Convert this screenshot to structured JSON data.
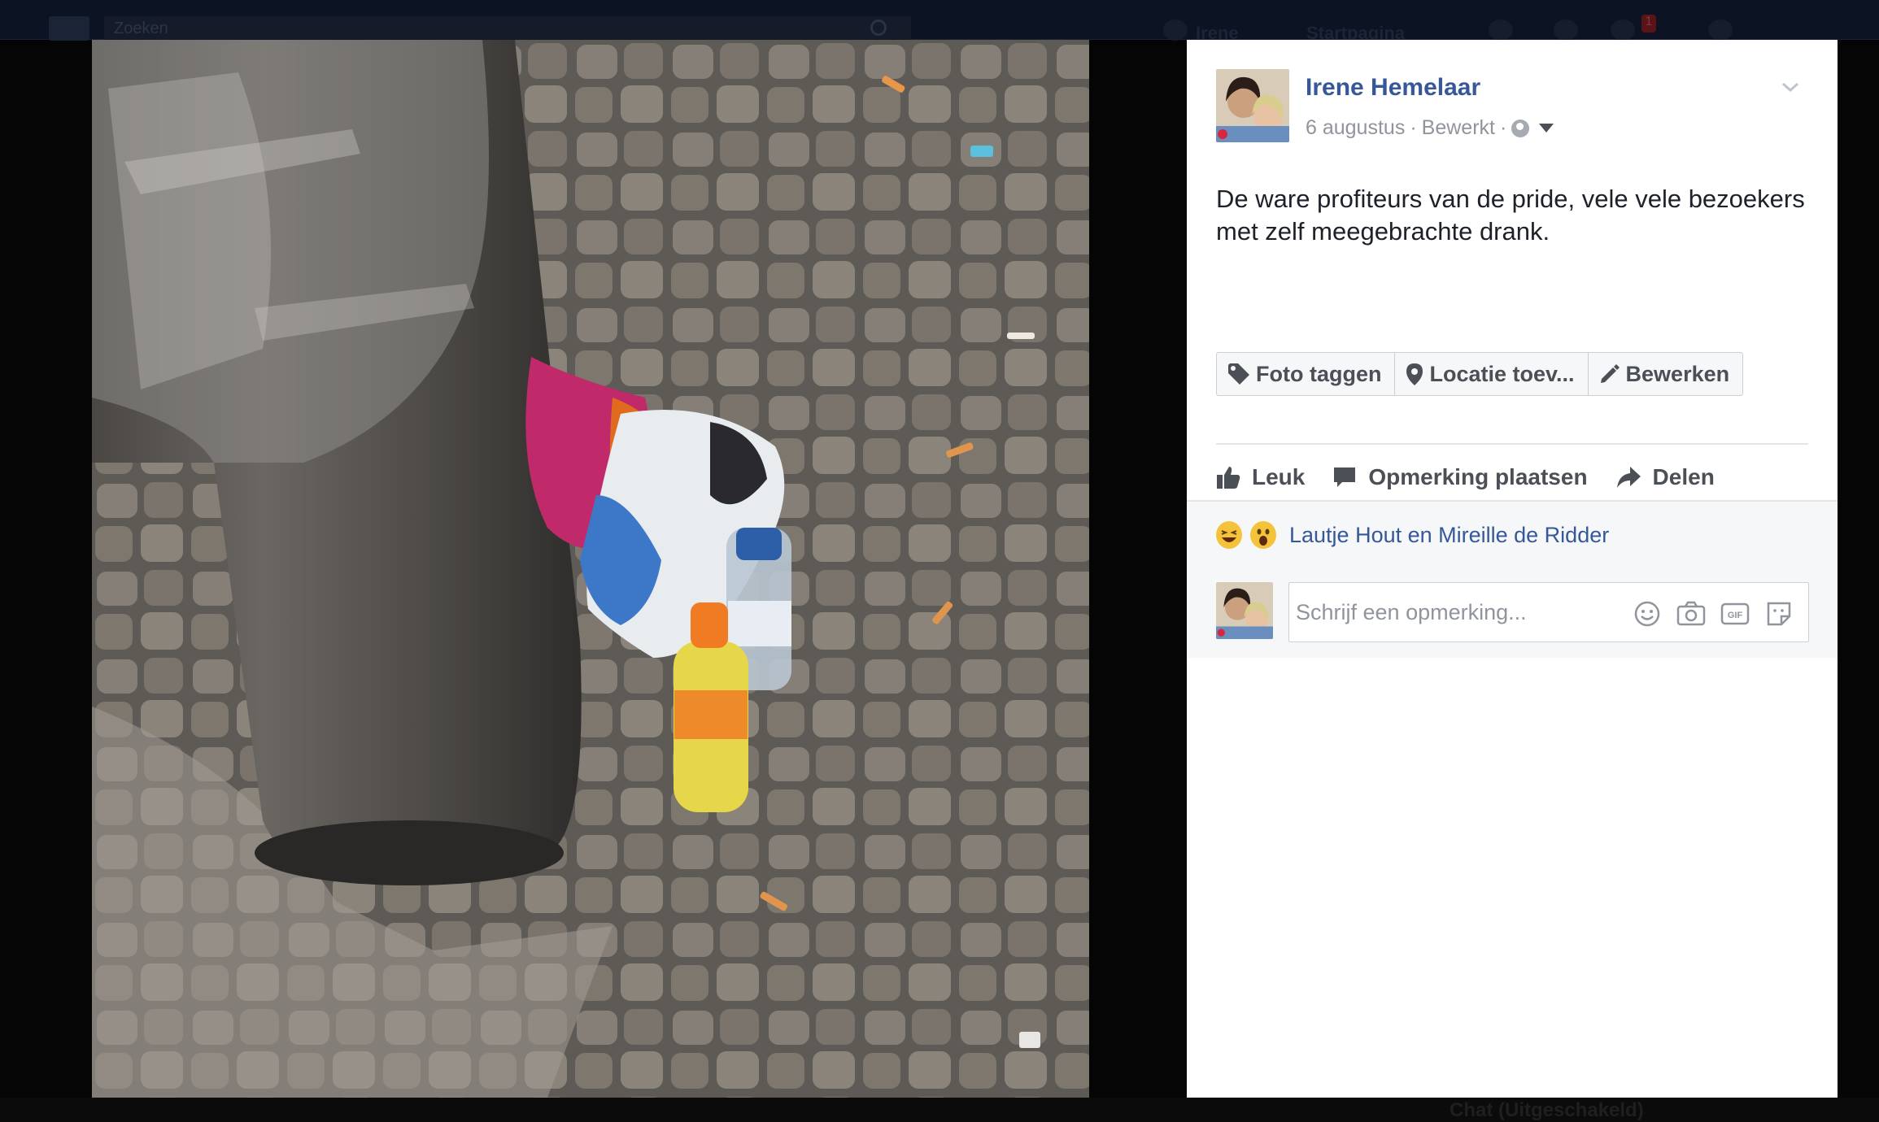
{
  "topbar": {
    "search_placeholder": "Zoeken",
    "nav_home": "Irene",
    "nav_start": "Startpagina",
    "notif_count": "1"
  },
  "bottom": {
    "chat_status": "Chat (Uitgeschakeld)"
  },
  "post": {
    "author": "Irene Hemelaar",
    "date": "6 augustus",
    "edited": "Bewerkt",
    "separator": "·",
    "text": "De ware profiteurs van de pride, vele vele bezoekers met zelf meegebrachte drank.",
    "photo_buttons": {
      "tag": "Foto taggen",
      "location": "Locatie toev...",
      "edit": "Bewerken"
    },
    "actions": {
      "like": "Leuk",
      "comment": "Opmerking plaatsen",
      "share": "Delen"
    },
    "reactions": {
      "emojis": [
        "laughing-emoji",
        "wow-emoji"
      ],
      "names": "Lautje Hout en Mireille de Ridder"
    },
    "comment_placeholder": "Schrijf een opmerking...",
    "comment_icons": [
      "emoji-icon",
      "camera-icon",
      "gif-icon",
      "sticker-icon"
    ]
  },
  "colors": {
    "link": "#365899",
    "meta": "#90949c",
    "text": "#1d2129",
    "button_bg": "#f6f7f9"
  }
}
